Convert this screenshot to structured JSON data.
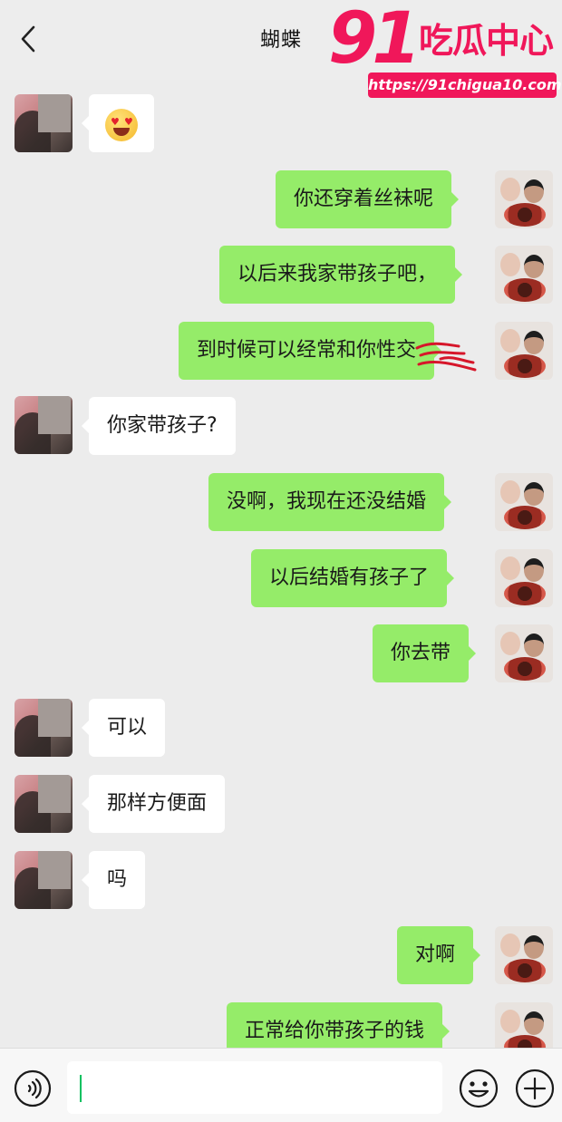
{
  "header": {
    "back_icon": "chevron-left-icon",
    "title": "蝴蝶"
  },
  "watermark": {
    "brand_number": "91",
    "brand_text": "吃瓜中心",
    "url": "https://91chigua10.com"
  },
  "messages": [
    {
      "side": "in",
      "type": "emoji",
      "emoji_name": "heart-eyes-emoji-icon",
      "text": ""
    },
    {
      "side": "out",
      "text": "你还穿着丝袜呢"
    },
    {
      "side": "out",
      "text": "以后来我家带孩子吧，"
    },
    {
      "side": "out",
      "text": "到时候可以经常和你性交",
      "note_icon": "red-scribble-redaction"
    },
    {
      "side": "in",
      "text": "你家带孩子?"
    },
    {
      "side": "out",
      "text": "没啊，我现在还没结婚"
    },
    {
      "side": "out",
      "text": "以后结婚有孩子了"
    },
    {
      "side": "out",
      "text": "你去带"
    },
    {
      "side": "in",
      "text": "可以"
    },
    {
      "side": "in",
      "text": "那样方便面"
    },
    {
      "side": "in",
      "text": "吗"
    },
    {
      "side": "out",
      "text": "对啊"
    },
    {
      "side": "out",
      "text": "正常给你带孩子的钱"
    }
  ],
  "input": {
    "value": "",
    "voice_icon": "voice-icon",
    "emoji_icon": "emoji-icon",
    "plus_icon": "plus-icon"
  },
  "colors": {
    "background": "#ececec",
    "outgoing_bubble": "#95ec69",
    "incoming_bubble": "#ffffff",
    "watermark": "#f0175a",
    "caret": "#07c160"
  }
}
